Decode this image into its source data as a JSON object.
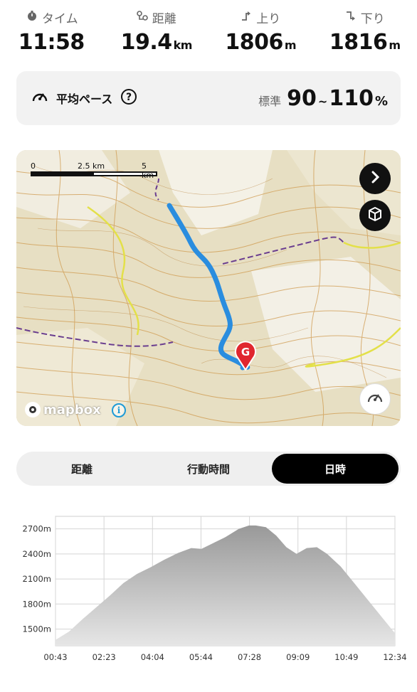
{
  "stats": [
    {
      "id": "time",
      "label": "タイム",
      "icon": "stopwatch-icon",
      "value": "11:58",
      "unit": ""
    },
    {
      "id": "distance",
      "label": "距離",
      "icon": "route-pin-icon",
      "value": "19.4",
      "unit": "km"
    },
    {
      "id": "ascent",
      "label": "上り",
      "icon": "arrow-up-right-icon",
      "value": "1806",
      "unit": "m"
    },
    {
      "id": "descent",
      "label": "下り",
      "icon": "arrow-down-right-icon",
      "value": "1816",
      "unit": "m"
    }
  ],
  "pace": {
    "label": "平均ペース",
    "standard_label": "標準",
    "low": "90",
    "separator": "~",
    "high": "110",
    "unit": "%"
  },
  "map": {
    "scale_labels": [
      "0",
      "2.5 km",
      "5 km"
    ],
    "attribution": "mapbox",
    "goal_label": "G",
    "route_color": "#2a8ddf"
  },
  "tabs": [
    {
      "label": "距離",
      "active": false
    },
    {
      "label": "行動時間",
      "active": false
    },
    {
      "label": "日時",
      "active": true
    }
  ],
  "chart_data": {
    "type": "area",
    "x_ticks": [
      "00:43",
      "02:23",
      "04:04",
      "05:44",
      "07:28",
      "09:09",
      "10:49",
      "12:34"
    ],
    "y_ticks": [
      "1500m",
      "1800m",
      "2100m",
      "2400m",
      "2700m"
    ],
    "ylim": [
      1300,
      2850
    ],
    "x": [
      0.0,
      0.04,
      0.08,
      0.12,
      0.16,
      0.2,
      0.24,
      0.28,
      0.32,
      0.36,
      0.4,
      0.43,
      0.46,
      0.5,
      0.54,
      0.57,
      0.59,
      0.62,
      0.65,
      0.68,
      0.71,
      0.74,
      0.77,
      0.8,
      0.84,
      0.88,
      0.92,
      0.96,
      1.0
    ],
    "y": [
      1370,
      1470,
      1620,
      1760,
      1900,
      2050,
      2160,
      2240,
      2330,
      2410,
      2470,
      2460,
      2520,
      2600,
      2700,
      2740,
      2740,
      2720,
      2620,
      2480,
      2400,
      2470,
      2480,
      2400,
      2250,
      2050,
      1850,
      1650,
      1450
    ],
    "fill_top": "#999999",
    "fill_bottom": "#e6e6e6"
  }
}
